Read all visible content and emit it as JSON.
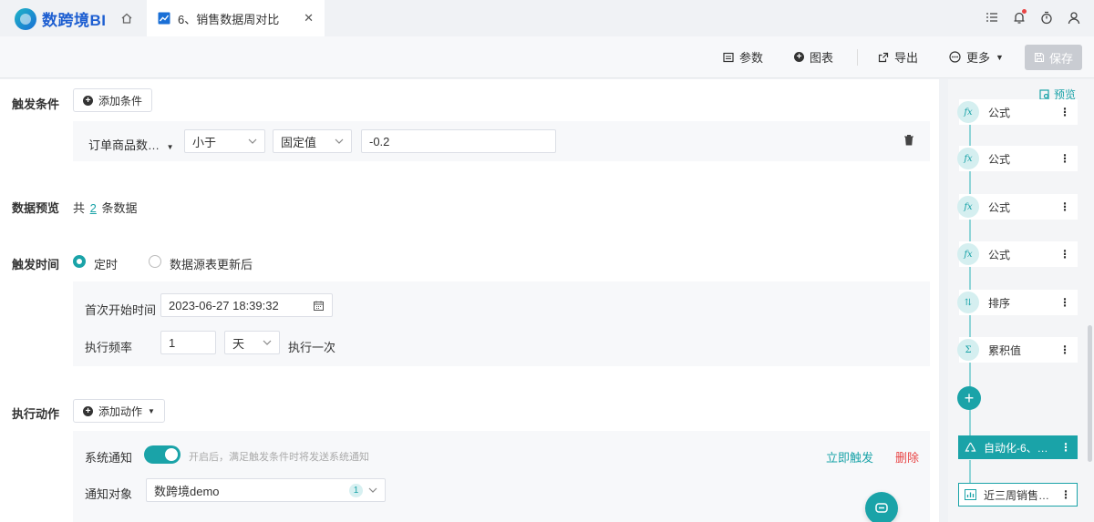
{
  "app": {
    "brand": "数跨境BI"
  },
  "tabs": [
    {
      "label": "6、销售数据周对比",
      "icon": "line-chart-icon"
    }
  ],
  "header_icons": [
    "list-icon",
    "bell-icon",
    "timer-icon",
    "user-icon"
  ],
  "toolbar": {
    "params": "参数",
    "chart": "图表",
    "export": "导出",
    "more": "更多",
    "save": "保存"
  },
  "trigger": {
    "label": "触发条件",
    "add_condition": "添加条件",
    "field": "订单商品数…",
    "operator": "小于",
    "value_type": "固定值",
    "value": "-0.2"
  },
  "preview": {
    "label": "数据预览",
    "prefix": "共",
    "count": "2",
    "suffix": "条数据"
  },
  "trigger_time": {
    "label": "触发时间",
    "option_scheduled": "定时",
    "option_source_update": "数据源表更新后",
    "start_label": "首次开始时间",
    "start_value": "2023-06-27 18:39:32",
    "freq_label": "执行频率",
    "freq_value": "1",
    "freq_unit": "天",
    "freq_suffix": "执行一次"
  },
  "action": {
    "label": "执行动作",
    "add_action": "添加动作",
    "sys_notify_label": "系统通知",
    "sys_notify_hint": "开启后，满足触发条件时将发送系统通知",
    "trigger_now": "立即触发",
    "delete": "删除",
    "target_label": "通知对象",
    "target_value": "数跨境demo",
    "target_count": "1"
  },
  "flow": {
    "preview_link": "预览",
    "nodes": [
      {
        "label": "公式",
        "icon": "fx-icon"
      },
      {
        "label": "公式",
        "icon": "fx-icon"
      },
      {
        "label": "公式",
        "icon": "fx-icon"
      },
      {
        "label": "公式",
        "icon": "fx-icon"
      },
      {
        "label": "排序",
        "icon": "sort-icon"
      },
      {
        "label": "累积值",
        "icon": "cumulative-icon"
      }
    ],
    "automation_node": "自动化-6、…",
    "chart_node": "近三周销售…"
  },
  "colors": {
    "accent": "#1aa3a8",
    "danger": "#e84545",
    "brand": "#1e5fd1"
  }
}
